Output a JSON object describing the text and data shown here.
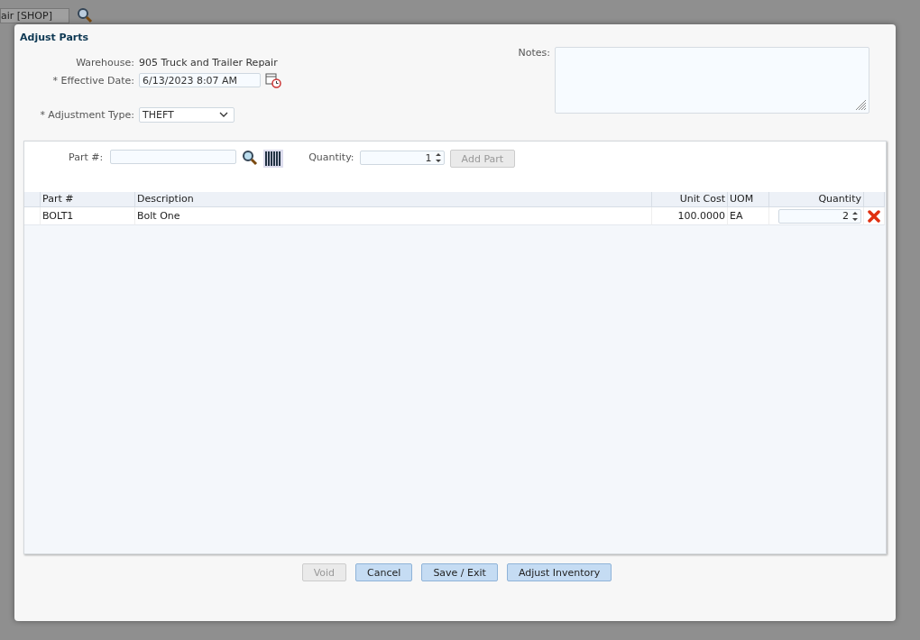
{
  "background": {
    "field_value": "air [SHOP]"
  },
  "dialog": {
    "title": "Adjust Parts",
    "warehouse": {
      "label": "Warehouse:",
      "value": "905 Truck and Trailer Repair"
    },
    "effective_date": {
      "label": "* Effective Date:",
      "value": "6/13/2023 8:07 AM"
    },
    "adjustment_type": {
      "label": "* Adjustment Type:",
      "value": "THEFT"
    },
    "notes": {
      "label": "Notes:"
    },
    "part_entry": {
      "part_label": "Part #:",
      "quantity_label": "Quantity:",
      "quantity_value": "1",
      "add_button": {
        "label": "Add Part",
        "disabled": true
      }
    },
    "table": {
      "columns": [
        {
          "label": "Part #"
        },
        {
          "label": "Description"
        },
        {
          "label": "Unit Cost"
        },
        {
          "label": "UOM"
        },
        {
          "label": "Quantity"
        }
      ],
      "rows": [
        {
          "part": "BOLT1",
          "description": "Bolt One",
          "unit_cost": "100.0000",
          "uom": "EA",
          "quantity": "2"
        }
      ]
    },
    "buttons": [
      {
        "label": "Void",
        "disabled": true
      },
      {
        "label": "Cancel",
        "disabled": false
      },
      {
        "label": "Save / Exit",
        "disabled": false
      },
      {
        "label": "Adjust Inventory",
        "disabled": false
      }
    ]
  }
}
